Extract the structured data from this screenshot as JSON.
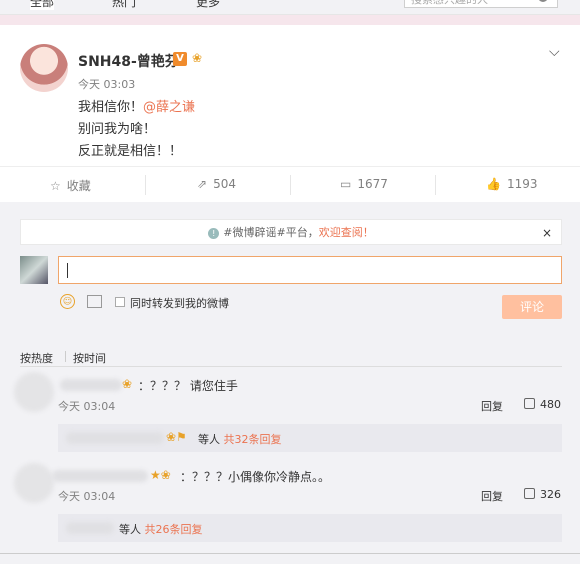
{
  "topbar": {
    "tabs": [
      "全部",
      "热门",
      "更多"
    ],
    "search_placeholder": "搜索感兴趣的人"
  },
  "post": {
    "username": "SNH48-曾艳芬",
    "verified_label": "V",
    "time": "今天 03:03",
    "line1": "我相信你！",
    "mention": "@薛之谦",
    "line2": "别问我为啥！",
    "line3": "反正就是相信！！"
  },
  "actions": {
    "favorite": "收藏",
    "repost": "504",
    "comment": "1677",
    "like": "1193"
  },
  "notice": {
    "text": "#微博辟谣#平台，",
    "link": "欢迎查阅！",
    "close": "×"
  },
  "composer": {
    "repost_checkbox_label": "同时转发到我的微博",
    "submit": "评论"
  },
  "sort": {
    "hot": "按热度",
    "time": "按时间"
  },
  "comments": [
    {
      "text": "：？？？ 请您住手",
      "time": "今天 03:04",
      "reply": "回复",
      "likes": "480",
      "sub_suffix": "等人",
      "sub_link": "共32条回复"
    },
    {
      "text": "：？？？小偶像你冷静点。。",
      "time": "今天 03:04",
      "reply": "回复",
      "likes": "326",
      "sub_suffix": "等人",
      "sub_link": "共26条回复"
    }
  ]
}
